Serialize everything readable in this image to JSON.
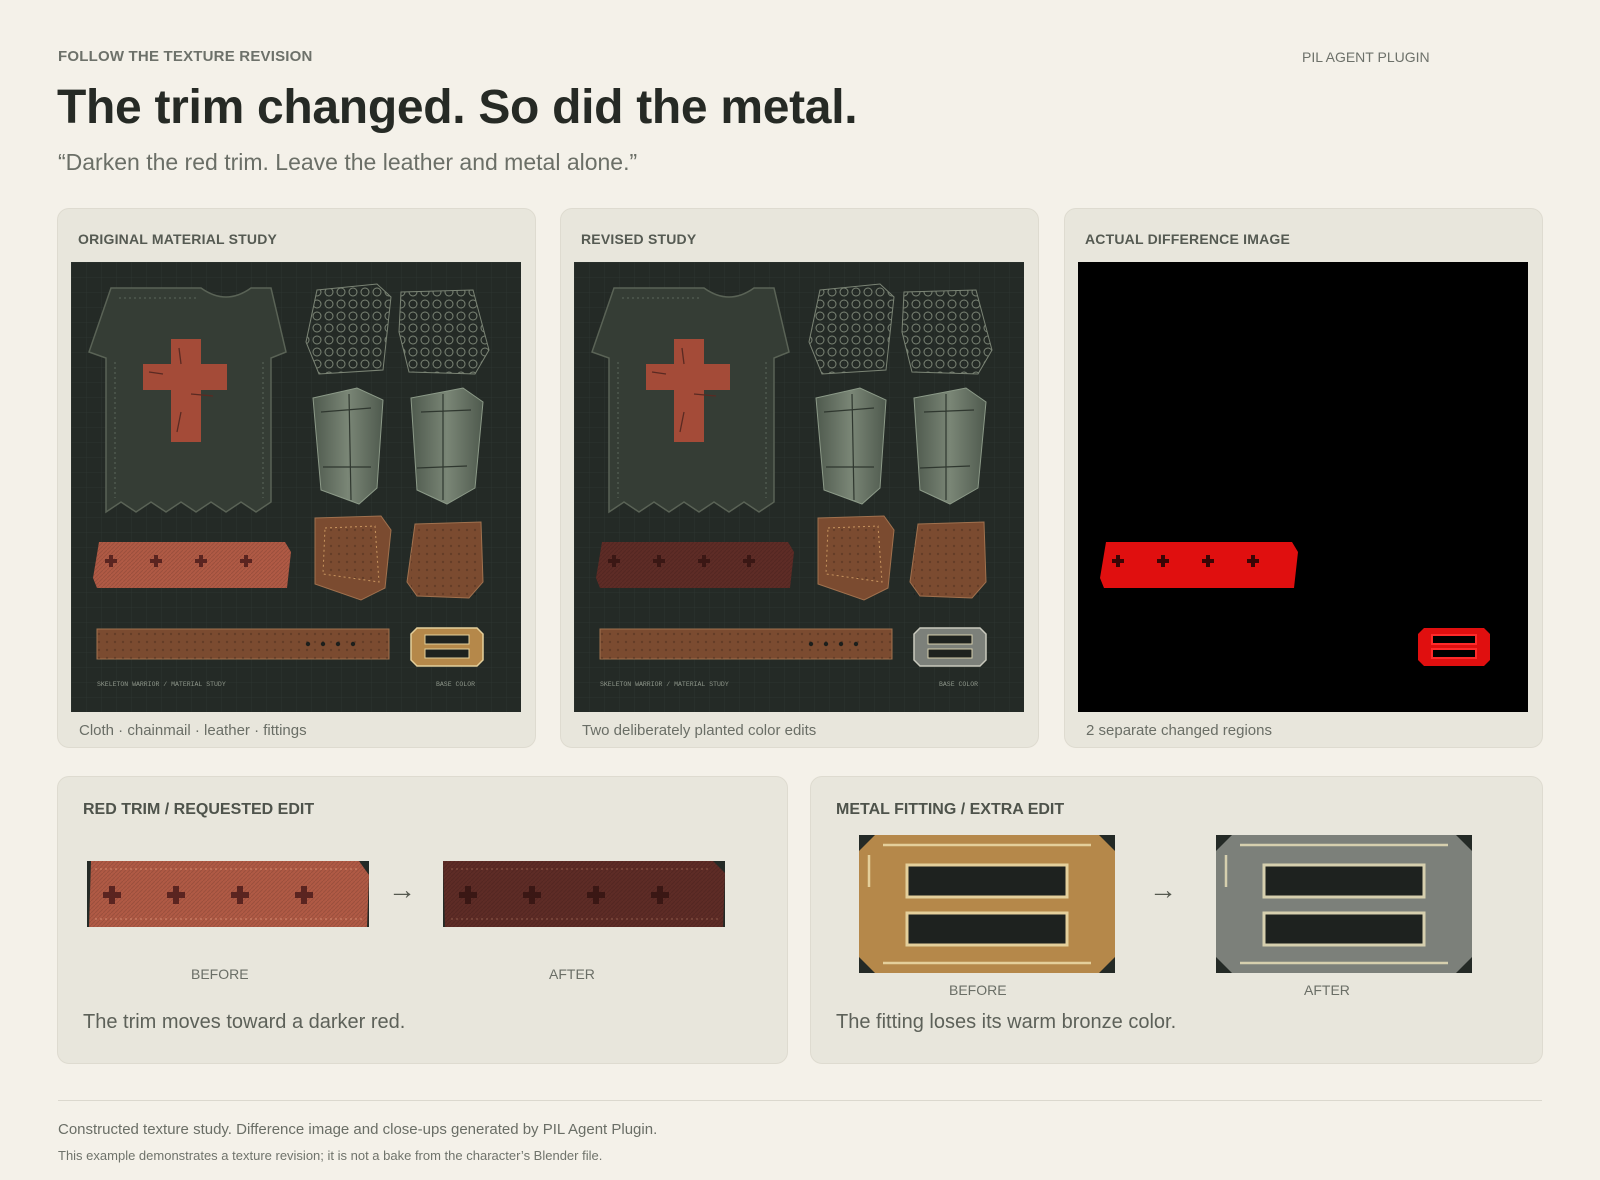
{
  "header": {
    "eyebrow": "FOLLOW THE TEXTURE REVISION",
    "plugin": "PIL AGENT PLUGIN",
    "title": "The trim changed. So did the metal.",
    "quote": "“Darken the red trim. Leave the leather and metal alone.”"
  },
  "panels": {
    "original": {
      "label": "ORIGINAL MATERIAL STUDY",
      "caption": "Cloth · chainmail · leather · fittings",
      "sheet_title": "SKELETON WARRIOR / MATERIAL STUDY",
      "sheet_tag": "BASE COLOR"
    },
    "revised": {
      "label": "REVISED STUDY",
      "caption": "Two deliberately planted color edits",
      "sheet_title": "SKELETON WARRIOR / MATERIAL STUDY",
      "sheet_tag": "BASE COLOR"
    },
    "difference": {
      "label": "ACTUAL DIFFERENCE IMAGE",
      "caption": "2 separate changed regions"
    }
  },
  "closeups": {
    "trim": {
      "label": "RED TRIM / REQUESTED EDIT",
      "before": "BEFORE",
      "after": "AFTER",
      "arrow": "→",
      "note": "The trim moves toward a darker red."
    },
    "fitting": {
      "label": "METAL FITTING / EXTRA EDIT",
      "before": "BEFORE",
      "after": "AFTER",
      "arrow": "→",
      "note": "The fitting loses its warm bronze color."
    }
  },
  "footer": {
    "line1": "Constructed texture study. Difference image and close-ups generated by PIL Agent Plugin.",
    "line2": "This example demonstrates a texture revision; it is not a bake from the character’s Blender file."
  },
  "colors": {
    "page_bg": "#f4f1e9",
    "card_bg": "#e8e6dc",
    "sheet_bg": "#242a26",
    "trim_before": "#b05a45",
    "trim_after": "#5e2c26",
    "fitting_before": "#b5884a",
    "fitting_after": "#7c807a",
    "diff_red": "#e00f0f"
  }
}
